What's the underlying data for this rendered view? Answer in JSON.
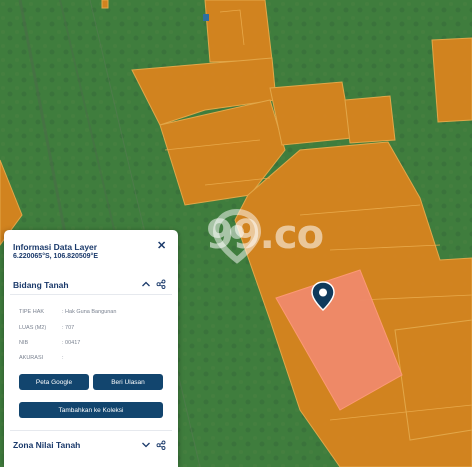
{
  "watermark": {
    "brand": "99.co"
  },
  "panel": {
    "title": "Informasi Data Layer",
    "coords": "6.220065°S, 106.820509°E",
    "close_icon": "close-icon",
    "section1": {
      "title": "Bidang Tanah",
      "rows": [
        {
          "label": "TIPE HAK",
          "value": ": Hak Guna Bangunan"
        },
        {
          "label": "LUAS (M2)",
          "value": ": 707"
        },
        {
          "label": "NIB",
          "value": ": 00417"
        },
        {
          "label": "AKURASI",
          "value": ":"
        }
      ],
      "buttons": {
        "peta_google": "Peta Google",
        "beri_ulasan": "Beri Ulasan",
        "tambahkan": "Tambahkan ke Koleksi"
      }
    },
    "section2": {
      "title": "Zona Nilai Tanah"
    }
  },
  "colors": {
    "vegetation": "#3f7d3d",
    "parcel": "#d6841f",
    "parcel_border": "#e8a94a",
    "selected_parcel": "#f08a6b",
    "panel_text": "#1b3a6b",
    "button": "#12456e",
    "pin": "#0f3a5c"
  }
}
